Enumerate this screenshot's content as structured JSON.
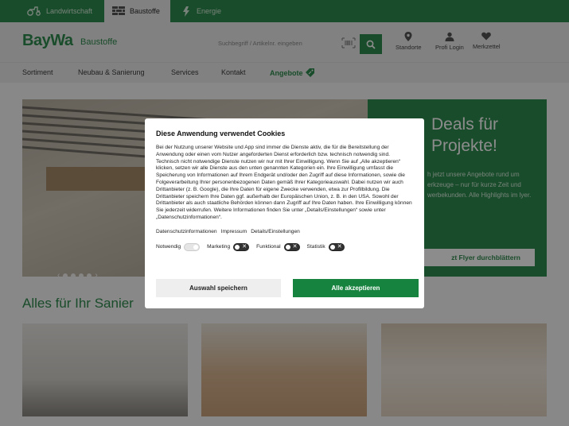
{
  "divisions": [
    {
      "label": "Landwirtschaft",
      "icon": "tractor-icon"
    },
    {
      "label": "Baustoffe",
      "icon": "bricks-icon",
      "active": true
    },
    {
      "label": "Energie",
      "icon": "energy-icon"
    }
  ],
  "header": {
    "logo": "BayWa",
    "logo_sub": "Baustoffe",
    "search_placeholder": "Suchbegriff / Artikelnr. eingeben",
    "links": [
      {
        "label": "Standorte",
        "icon": "location-pin-icon"
      },
      {
        "label": "Profi Login",
        "icon": "user-icon"
      },
      {
        "label": "Merkzettel",
        "icon": "heart-icon"
      }
    ]
  },
  "nav": [
    "Sortiment",
    "Neubau & Sanierung",
    "Services",
    "Kontakt",
    "Angebote"
  ],
  "hero": {
    "title": "Deals für Projekte!",
    "text": "h jetzt unsere Angebote rund um erkzeuge – nur für kurze Zeit und werbekunden. Alle Highlights im lyer.",
    "button": "zt Flyer durchblättern"
  },
  "section_title": "Alles für Ihr Sanier",
  "cookie": {
    "title": "Diese Anwendung verwendet Cookies",
    "body": "Bei der Nutzung unserer Website und App sind immer die Dienste aktiv, die für die Bereitstellung der Anwendung oder einen vom Nutzer angeforderten Dienst erforderlich bzw. technisch notwendig sind. Technisch nicht notwendige Dienste nutzen wir nur mit Ihrer Einwilligung. Wenn Sie auf „Alle akzeptieren“ klicken, setzen wir alle Dienste aus den unten genannten Kategorien ein. Ihre Einwilligung umfasst die Speicherung von Informationen auf Ihrem Endgerät und/oder den Zugriff auf diese Informationen, sowie die Folgeverarbeitung Ihrer personenbezogenen Daten gemäß Ihrer Kategorieauswahl. Dabei nutzen wir auch Drittanbieter (z. B. Google), die Ihre Daten für eigene Zwecke verwenden, etwa zur Profilbildung. Die Drittanbieter speichern Ihre Daten ggf. außerhalb der Europäischen Union, z. B. in den USA. Sowohl der Drittanbieter als auch staatliche Behörden können dann Zugriff auf Ihre Daten haben. Ihre Einwilligung können Sie jederzeit widerrufen. Weitere Informationen finden Sie unter „Details/Einstellungen“ sowie unter „Datenschutzinformationen“.",
    "links": [
      "Datenschutzinformationen",
      "Impressum",
      "Details/Einstellungen"
    ],
    "toggles": [
      {
        "label": "Notwendig",
        "state": "disabled-on"
      },
      {
        "label": "Marketing",
        "state": "off"
      },
      {
        "label": "Funktional",
        "state": "off"
      },
      {
        "label": "Statistik",
        "state": "off"
      }
    ],
    "save_label": "Auswahl speichern",
    "accept_label": "Alle akzeptieren"
  },
  "colors": {
    "brand": "#2f8a4e",
    "accept": "#16833f"
  }
}
